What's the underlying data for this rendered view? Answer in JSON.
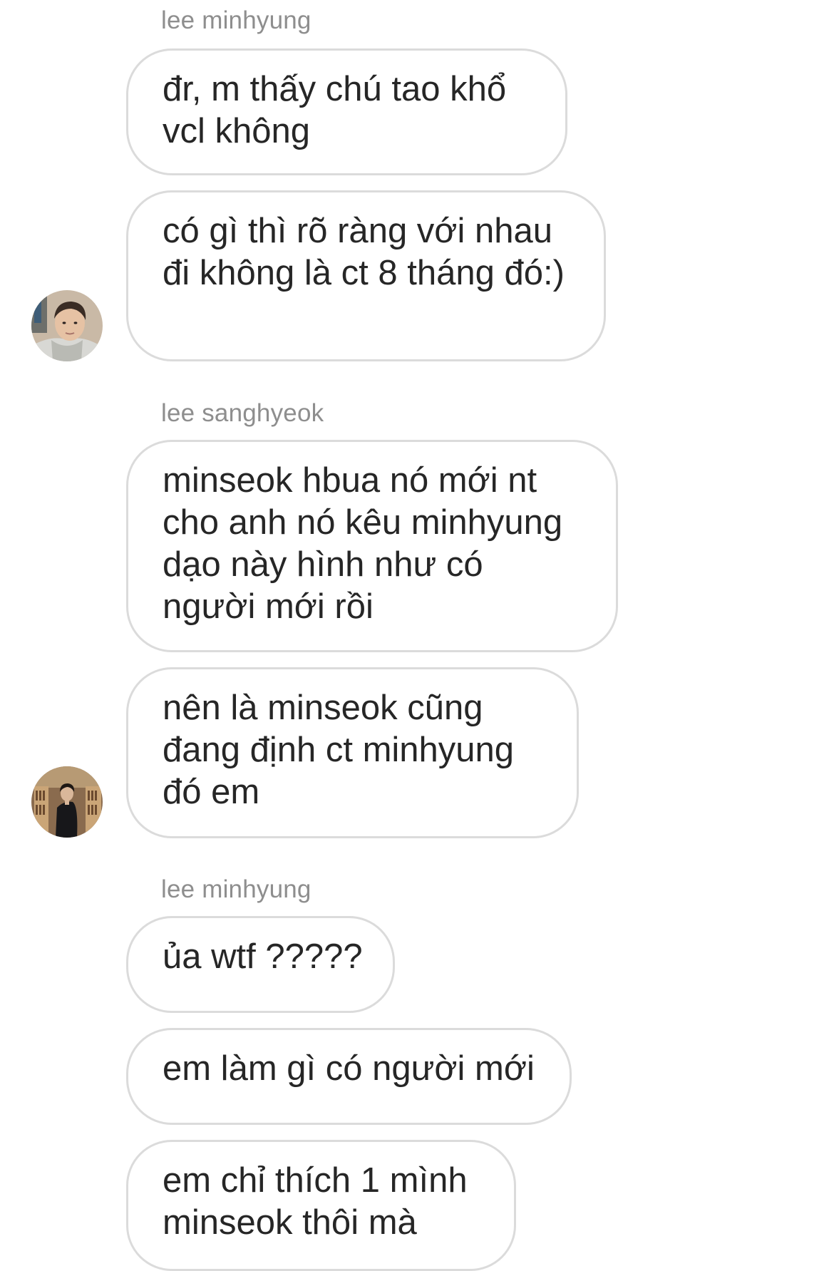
{
  "thread": {
    "groups": [
      {
        "sender": "lee minhyung",
        "avatar_icon": "user-avatar-minhyung",
        "messages": [
          "đr, m thấy chú tao khổ vcl không",
          "có gì thì rõ ràng với nhau đi không là ct 8 tháng đó:)"
        ]
      },
      {
        "sender": "lee sanghyeok",
        "avatar_icon": "user-avatar-sanghyeok",
        "messages": [
          "minseok hbua nó mới nt cho anh nó kêu minhyung dạo này hình như có người mới rồi",
          "nên là minseok cũng đang định ct minhyung đó em"
        ]
      },
      {
        "sender": "lee minhyung",
        "messages": [
          "ủa wtf ?????",
          "em làm gì có người mới",
          "em chỉ thích 1 mình minseok thôi mà"
        ]
      }
    ]
  },
  "colors": {
    "bubble_border": "#dbdbdb",
    "sender_text": "#8e8e8e",
    "message_text": "#262626",
    "background": "#ffffff"
  }
}
